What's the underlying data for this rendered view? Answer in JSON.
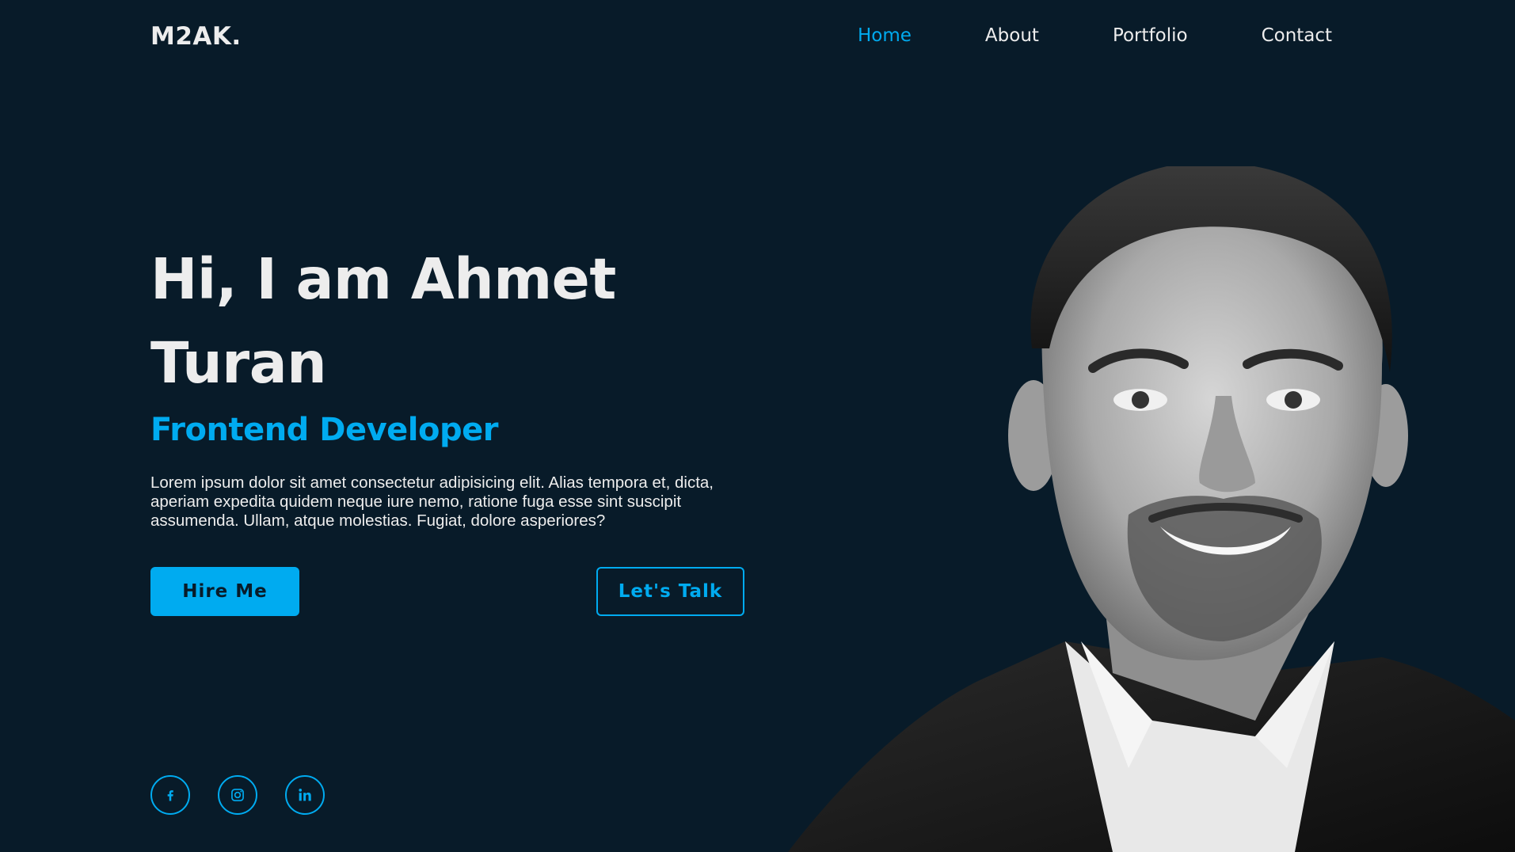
{
  "header": {
    "logo": "M2AK.",
    "nav": [
      {
        "label": "Home",
        "active": true
      },
      {
        "label": "About",
        "active": false
      },
      {
        "label": "Portfolio",
        "active": false
      },
      {
        "label": "Contact",
        "active": false
      }
    ]
  },
  "hero": {
    "title": "Hi, I am Ahmet Turan",
    "subtitle": "Frontend Developer",
    "description": "Lorem ipsum dolor sit amet consectetur adipisicing elit. Alias tempora et, dicta, aperiam expedita quidem neque iure nemo, ratione fuga esse sint suscipit assumenda. Ullam, atque molestias. Fugiat, dolore asperiores?",
    "buttons": {
      "hire": "Hire Me",
      "talk": "Let's Talk"
    }
  },
  "social": [
    {
      "icon": "facebook-icon"
    },
    {
      "icon": "instagram-icon"
    },
    {
      "icon": "linkedin-icon"
    }
  ],
  "colors": {
    "background": "#081b29",
    "accent": "#00abf0",
    "text": "#ededed"
  }
}
